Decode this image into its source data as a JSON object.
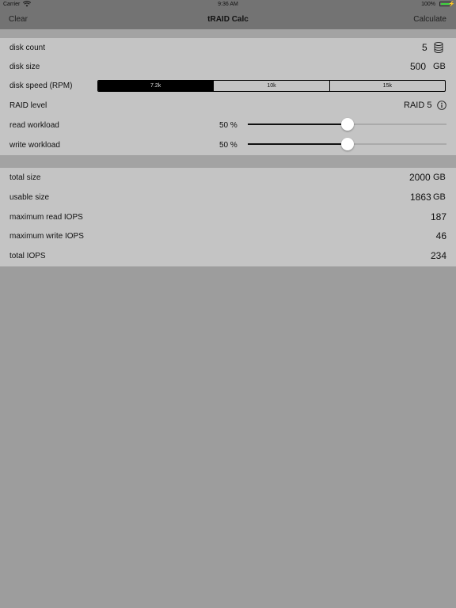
{
  "status_bar": {
    "carrier": "Carrier",
    "time": "9:36 AM",
    "battery_percent": "100%",
    "battery_level": 1.0
  },
  "nav": {
    "left": "Clear",
    "title": "tRAID Calc",
    "right": "Calculate"
  },
  "inputs": {
    "disk_count": {
      "label": "disk count",
      "value": "5"
    },
    "disk_size": {
      "label": "disk size",
      "value": "500",
      "unit": "GB"
    },
    "disk_speed": {
      "label": "disk speed (RPM)",
      "options": [
        "7.2k",
        "10k",
        "15k"
      ],
      "selected": "7.2k"
    },
    "raid_level": {
      "label": "RAID level",
      "value": "RAID 5"
    },
    "read_workload": {
      "label": "read workload",
      "value_text": "50 %",
      "value": 50
    },
    "write_workload": {
      "label": "write workload",
      "value_text": "50 %",
      "value": 50
    }
  },
  "results": {
    "total_size": {
      "label": "total size",
      "value": "2000",
      "unit": "GB"
    },
    "usable_size": {
      "label": "usable size",
      "value": "1863",
      "unit": "GB"
    },
    "max_read_iops": {
      "label": "maximum read IOPS",
      "value": "187"
    },
    "max_write_iops": {
      "label": "maximum write IOPS",
      "value": "46"
    },
    "total_iops": {
      "label": "total IOPS",
      "value": "234"
    }
  },
  "icons": {
    "wifi": "wifi-icon",
    "battery": "battery-icon",
    "disk_stack": "database-icon",
    "info": "info-icon"
  },
  "colors": {
    "bar": "#737373",
    "panel": "#c4c4c4",
    "background": "#9d9d9d",
    "battery_fill": "#3cd03c"
  }
}
